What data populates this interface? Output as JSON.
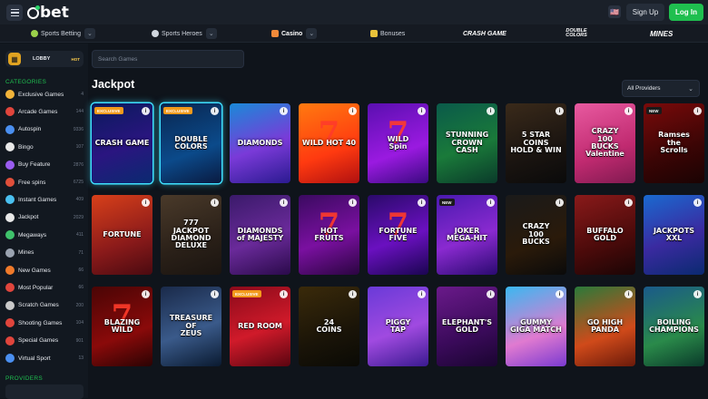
{
  "header": {
    "logo_text": "bet",
    "flag_icon": "us-flag-icon",
    "signup_label": "Sign Up",
    "login_label": "Log In"
  },
  "nav": {
    "items": [
      {
        "label": "Sports Betting",
        "icon": "soccer-ball-icon",
        "has_dropdown": true
      },
      {
        "label": "Sports Heroes",
        "icon": "football-icon",
        "has_dropdown": true
      },
      {
        "label": "Casino",
        "icon": "casino-chip-icon",
        "has_dropdown": true
      },
      {
        "label": "Bonuses",
        "icon": "gift-icon",
        "has_dropdown": false
      }
    ],
    "brands": [
      "CRASH GAME",
      "DOUBLE COLORS",
      "MINES"
    ]
  },
  "sidebar": {
    "lobby_label": "LOBBY",
    "lobby_badge": "HOT",
    "categories_heading": "CATEGORIES",
    "providers_heading": "PROVIDERS",
    "categories": [
      {
        "label": "Exclusive Games",
        "count": "4",
        "icon": "crown-icon",
        "color": "#f2b43a"
      },
      {
        "label": "Arcade Games",
        "count": "144",
        "icon": "joystick-icon",
        "color": "#e0453c"
      },
      {
        "label": "Autospin",
        "count": "9336",
        "icon": "autospin-icon",
        "color": "#4a8ff0"
      },
      {
        "label": "Bingo",
        "count": "107",
        "icon": "bingo-ball-icon",
        "color": "#e8e8e8"
      },
      {
        "label": "Buy Feature",
        "count": "2876",
        "icon": "buy-feature-icon",
        "color": "#9a5cf0"
      },
      {
        "label": "Free spins",
        "count": "6725",
        "icon": "free-spins-icon",
        "color": "#e04f3a"
      },
      {
        "label": "Instant Games",
        "count": "409",
        "icon": "instant-games-icon",
        "color": "#4ac0f0"
      },
      {
        "label": "Jackpot",
        "count": "2029",
        "icon": "jackpot-icon",
        "color": "#e8e8e8"
      },
      {
        "label": "Megaways",
        "count": "411",
        "icon": "megaways-icon",
        "color": "#3fc26b"
      },
      {
        "label": "Mines",
        "count": "71",
        "icon": "mine-icon",
        "color": "#9aa3b0"
      },
      {
        "label": "New Games",
        "count": "66",
        "icon": "flame-icon",
        "color": "#f07a2a"
      },
      {
        "label": "Most Popular",
        "count": "66",
        "icon": "heart-icon",
        "color": "#e0453c"
      },
      {
        "label": "Scratch Games",
        "count": "200",
        "icon": "scratch-card-icon",
        "color": "#c9c9c9"
      },
      {
        "label": "Shooting Games",
        "count": "104",
        "icon": "target-icon",
        "color": "#e0453c"
      },
      {
        "label": "Special Games",
        "count": "901",
        "icon": "special-games-icon",
        "color": "#e0453c"
      },
      {
        "label": "Virtual Sport",
        "count": "13",
        "icon": "globe-icon",
        "color": "#4a8ff0"
      }
    ]
  },
  "main": {
    "search_placeholder": "Search Games",
    "title": "Jackpot",
    "providers_select": "All Providers"
  },
  "games": [
    {
      "title": "CRASH GAME",
      "badge": "EXCLUSIVE",
      "bg": "linear-gradient(160deg,#0a1a5c,#2a1580 55%,#0a2a70)",
      "glow": true
    },
    {
      "title": "DOUBLE\nCOLORS",
      "badge": "EXCLUSIVE",
      "bg": "linear-gradient(160deg,#0a2650,#0b4a8a 60%,#0a1a40)",
      "glow": true
    },
    {
      "title": "DIAMONDS",
      "badge": "",
      "bg": "linear-gradient(160deg,#1a8ad8,#7a3ad8 55%,#2a1a90)",
      "glow": false
    },
    {
      "title": "WILD HOT 40",
      "badge": "",
      "bg": "linear-gradient(160deg,#ff7a10,#ff3a10 60%,#b01010)",
      "glow": false,
      "deco": "7"
    },
    {
      "title": "WILD\nSpin",
      "badge": "",
      "bg": "linear-gradient(160deg,#5a0fb0,#9a1ae0 60%,#3a0a80)",
      "glow": false,
      "deco": "7"
    },
    {
      "title": "STUNNING\nCROWN\nCASH",
      "badge": "",
      "bg": "linear-gradient(160deg,#0a5a4a,#1a7a3a 55%,#0a3a2a)",
      "glow": false
    },
    {
      "title": "5 STAR\nCOINS\nHOLD & WIN",
      "badge": "",
      "bg": "linear-gradient(160deg,#3a2a1a,#1a1410 60%,#0a0a0a)",
      "glow": false
    },
    {
      "title": "CRAZY\n100\nBUCKS\nValentine",
      "badge": "",
      "bg": "linear-gradient(160deg,#e85aa0,#c02a70 60%,#801a50)",
      "glow": false
    },
    {
      "title": "Ramses\nthe\nScrolls",
      "badge": "NEW",
      "bg": "linear-gradient(160deg,#7a0a0a,#3a0505 60%,#1a0303)",
      "glow": false
    },
    {
      "title": "FORTUNE",
      "badge": "",
      "bg": "linear-gradient(160deg,#d8401a,#8a1a1a 60%,#4a0a10)",
      "glow": false
    },
    {
      "title": "777\nJACKPOT\nDIAMOND\nDELUXE",
      "badge": "",
      "bg": "linear-gradient(160deg,#4a3a2a,#2a2018 60%,#1a1410)",
      "glow": false
    },
    {
      "title": "DIAMONDS\nof MAJESTY",
      "badge": "",
      "bg": "linear-gradient(160deg,#3a1a6a,#6a2a9a 55%,#2a0a4a)",
      "glow": false
    },
    {
      "title": "HOT\nFRUITS",
      "badge": "",
      "bg": "linear-gradient(160deg,#3a0a60,#7a10a0 55%,#2a0540)",
      "glow": false,
      "deco": "7"
    },
    {
      "title": "FORTUNE\nFIVE",
      "badge": "",
      "bg": "linear-gradient(160deg,#2a0a6a,#6a10c0 55%,#1a0550)",
      "glow": false,
      "deco": "7"
    },
    {
      "title": "JOKER\nMEGA-HIT",
      "badge": "NEW",
      "bg": "linear-gradient(160deg,#4a1ab0,#8a2ad0 55%,#2a0a70)",
      "glow": false
    },
    {
      "title": "CRAZY\n100\nBUCKS",
      "badge": "",
      "bg": "linear-gradient(160deg,#1a1a1a,#2a1a0a 60%,#0a0a0a)",
      "glow": false
    },
    {
      "title": "BUFFALO\nGOLD",
      "badge": "",
      "bg": "linear-gradient(160deg,#8a1a1a,#4a0a0a 60%,#1a0505)",
      "glow": false
    },
    {
      "title": "JACKPOTS\nXXL",
      "badge": "",
      "bg": "linear-gradient(160deg,#1a6ad0,#3a2aa0 55%,#0a2a70)",
      "glow": false
    },
    {
      "title": "BLAZING\nWILD",
      "badge": "",
      "bg": "linear-gradient(160deg,#4a0505,#8a0a0a 60%,#2a0303)",
      "glow": false,
      "deco": "7"
    },
    {
      "title": "TREASURE OF\nZEUS",
      "badge": "",
      "bg": "linear-gradient(160deg,#1a2a4a,#3a5a8a 55%,#0a1a30)",
      "glow": false
    },
    {
      "title": "RED ROOM",
      "badge": "EXCLUSIVE",
      "bg": "linear-gradient(160deg,#8a0a1a,#d01a2a 55%,#5a0510)",
      "glow": false
    },
    {
      "title": "24\nCOINS",
      "badge": "",
      "bg": "linear-gradient(160deg,#3a2a0a,#1a1408 60%,#0a0a05)",
      "glow": false
    },
    {
      "title": "PIGGY\nTAP",
      "badge": "",
      "bg": "linear-gradient(160deg,#6a3ad8,#a04ae0 55%,#3a1a90)",
      "glow": false
    },
    {
      "title": "ELEPHANT'S\nGOLD",
      "badge": "",
      "bg": "linear-gradient(160deg,#6a1a8a,#3a0a5a 60%,#1a0530)",
      "glow": false
    },
    {
      "title": "GUMMY\nGIGA MATCH",
      "badge": "",
      "bg": "linear-gradient(160deg,#3ab8f0,#e07ad0 60%,#7a3ad0)",
      "glow": false
    },
    {
      "title": "GO HIGH\nPANDA",
      "badge": "",
      "bg": "linear-gradient(160deg,#2a7a3a,#d04a1a 60%,#6a1a0a)",
      "glow": false
    },
    {
      "title": "BOILING\nCHAMPIONS",
      "badge": "",
      "bg": "linear-gradient(160deg,#1a5a8a,#2a8a4a 60%,#0a3a2a)",
      "glow": false
    }
  ]
}
